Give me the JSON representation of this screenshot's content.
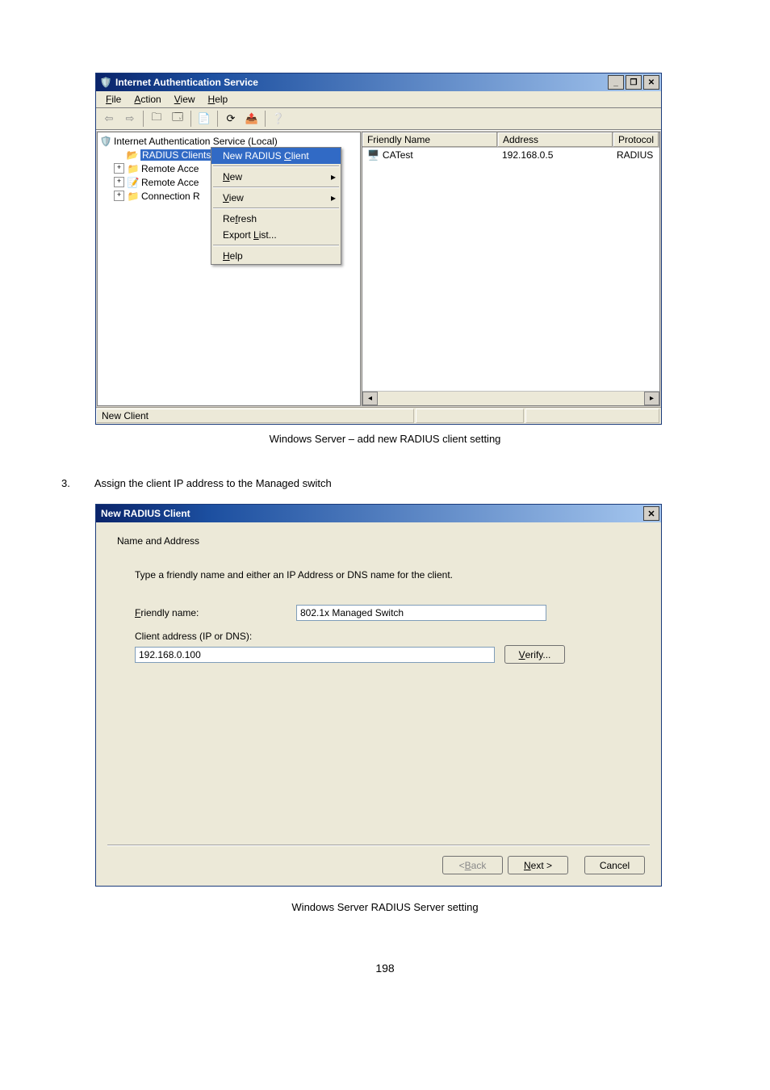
{
  "ias_window": {
    "title": "Internet Authentication Service",
    "sysbuttons": {
      "minimize": "_",
      "restore": "❐",
      "close": "✕"
    },
    "menubar": {
      "file": {
        "label_pre": "",
        "key": "F",
        "label_post": "ile"
      },
      "action": {
        "label_pre": "",
        "key": "A",
        "label_post": "ction"
      },
      "view": {
        "label_pre": "",
        "key": "V",
        "label_post": "iew"
      },
      "help": {
        "label_pre": "",
        "key": "H",
        "label_post": "elp"
      }
    },
    "tree": {
      "root": "Internet Authentication Service (Local)",
      "nodes": {
        "radius_clients": "RADIUS Clients",
        "remote_access_policies": "Remote Acce",
        "remote_access_logging": "Remote Acce",
        "connection_request": "Connection R"
      }
    },
    "context_menu": {
      "new_client": {
        "pre": "New RADIUS ",
        "key": "C",
        "post": "lient"
      },
      "new": {
        "key": "N",
        "post": "ew"
      },
      "view": {
        "key": "V",
        "post": "iew"
      },
      "refresh": {
        "pre": "Re",
        "key": "f",
        "post": "resh"
      },
      "export": {
        "pre": "Export ",
        "key": "L",
        "post": "ist..."
      },
      "help": {
        "key": "H",
        "post": "elp"
      }
    },
    "list": {
      "headers": {
        "name": "Friendly Name",
        "address": "Address",
        "protocol": "Protocol"
      },
      "rows": [
        {
          "name": "CATest",
          "address": "192.168.0.5",
          "protocol": "RADIUS"
        }
      ]
    },
    "statusbar": "New Client"
  },
  "caption1": "Windows Server – add new RADIUS client setting",
  "step3": {
    "num": "3.",
    "text": "Assign the client IP address to the Managed switch"
  },
  "new_client_dialog": {
    "title": "New RADIUS Client",
    "close": "✕",
    "group": "Name and Address",
    "instruction": "Type a friendly name and either an IP Address or DNS name for the client.",
    "friendly_label": {
      "key": "F",
      "post": "riendly name:"
    },
    "friendly_value": "802.1x Managed Switch",
    "addr_label": {
      "pre": "Client a",
      "key": "d",
      "post": "dress (IP or DNS):"
    },
    "addr_value": "192.168.0.100",
    "verify_btn": {
      "key": "V",
      "post": "erify..."
    },
    "back_btn": {
      "pre": "< ",
      "key": "B",
      "post": "ack"
    },
    "next_btn": {
      "key": "N",
      "post": "ext >"
    },
    "cancel_btn": "Cancel"
  },
  "caption2": "Windows Server RADIUS Server setting",
  "page_number": "198"
}
